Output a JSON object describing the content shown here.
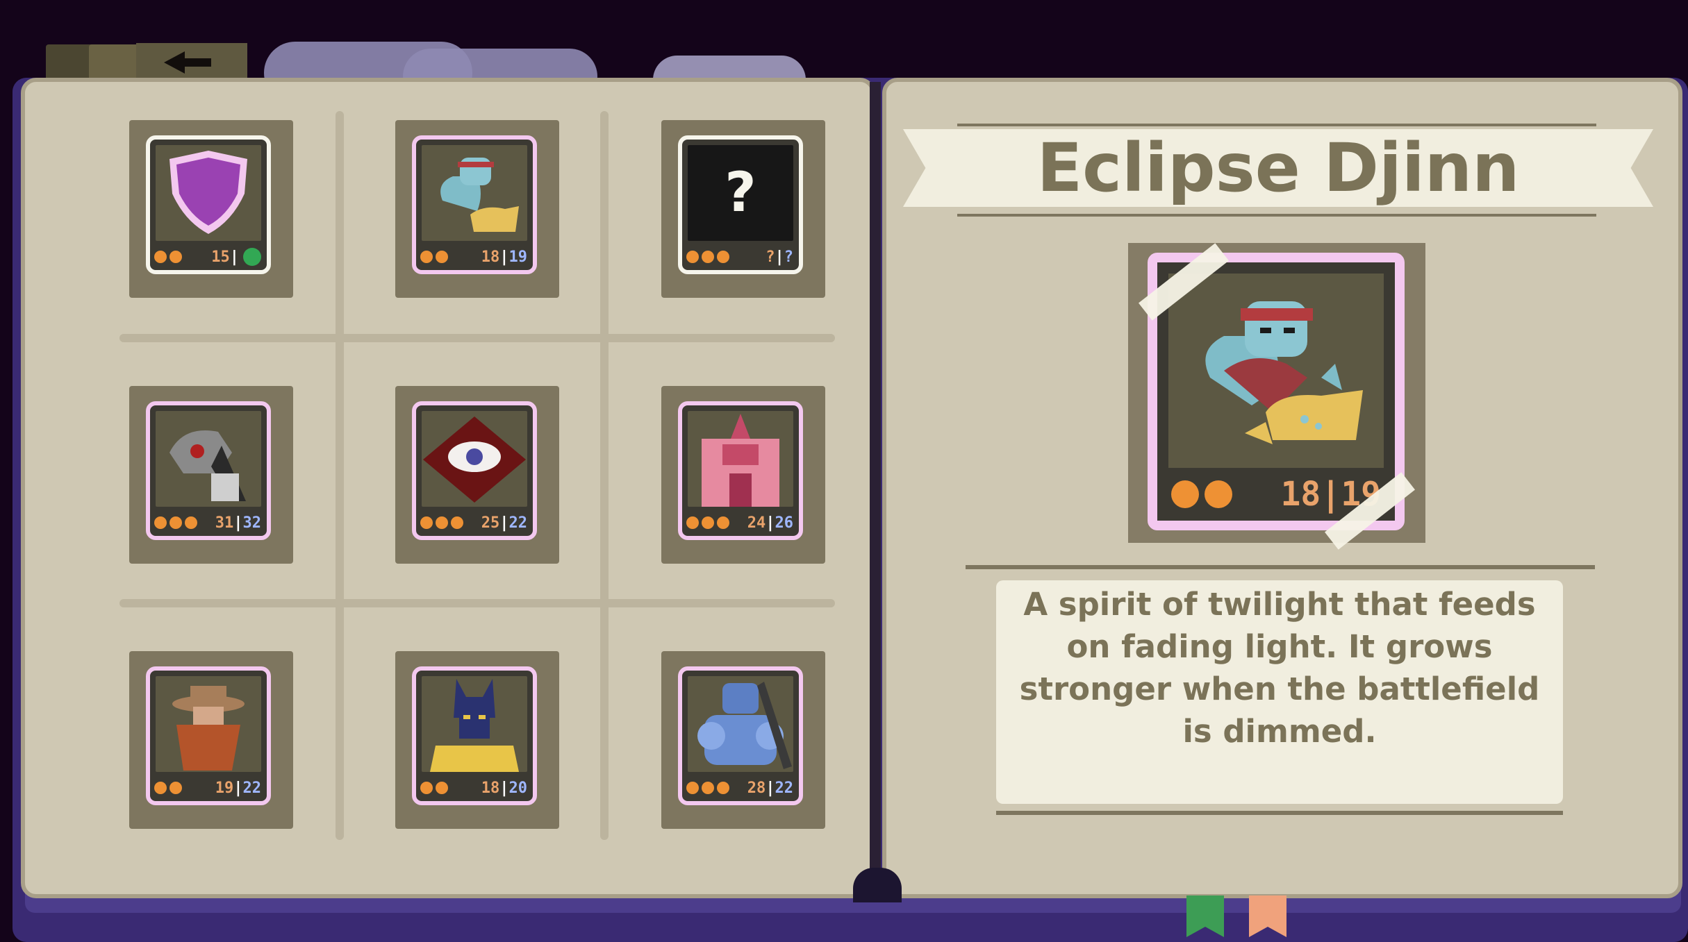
{
  "nav": {
    "back_icon": "arrow-left-icon"
  },
  "grid": {
    "cards": [
      {
        "name": "shield",
        "icon": "purple-shield-icon",
        "pips": 2,
        "attack": "15",
        "hp": "",
        "frame": "white",
        "badge": "green-dot"
      },
      {
        "name": "eclipse-djinn",
        "icon": "djinn-icon",
        "pips": 2,
        "attack": "18",
        "hp": "19",
        "frame": "pink"
      },
      {
        "name": "unknown",
        "icon": "question-mark-icon",
        "pips": 3,
        "attack": "?",
        "hp": "?",
        "frame": "white"
      },
      {
        "name": "bone-serpent",
        "icon": "skeletal-wyrm-icon",
        "pips": 3,
        "attack": "31",
        "hp": "32",
        "frame": "pink"
      },
      {
        "name": "crimson-eye",
        "icon": "red-eye-icon",
        "pips": 3,
        "attack": "25",
        "hp": "22",
        "frame": "pink"
      },
      {
        "name": "pink-mech",
        "icon": "pink-mech-icon",
        "pips": 3,
        "attack": "24",
        "hp": "26",
        "frame": "pink"
      },
      {
        "name": "cowboy",
        "icon": "cowboy-icon",
        "pips": 2,
        "attack": "19",
        "hp": "22",
        "frame": "pink"
      },
      {
        "name": "anubis",
        "icon": "jackal-pharaoh-icon",
        "pips": 2,
        "attack": "18",
        "hp": "20",
        "frame": "pink"
      },
      {
        "name": "blue-golem",
        "icon": "blue-knight-icon",
        "pips": 3,
        "attack": "28",
        "hp": "22",
        "frame": "pink"
      }
    ]
  },
  "detail": {
    "title": "Eclipse Djinn",
    "icon": "djinn-icon",
    "pips": 2,
    "attack": "18",
    "hp": "19",
    "description": "A spirit of twilight that feeds on fading light. It grows stronger when the battlefield is dimmed."
  },
  "bookmarks": [
    {
      "color": "#3d9d55"
    },
    {
      "color": "#f0a27c"
    }
  ],
  "colors": {
    "attack": "#e9a36b",
    "hp": "#9fb7ff",
    "pip": "#ee9134",
    "frame": "#f3c8ef"
  }
}
